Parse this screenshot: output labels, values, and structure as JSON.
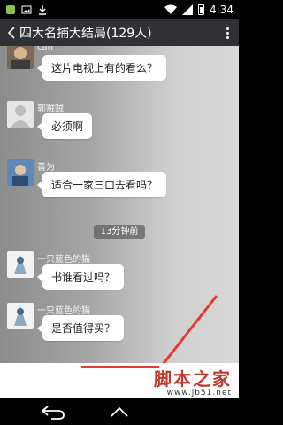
{
  "status_bar": {
    "time": "4:34",
    "left_icons": [
      "notification-icon",
      "image-icon",
      "download-icon"
    ],
    "right_icons": [
      "wifi-icon",
      "signal-icon",
      "battery-icon"
    ]
  },
  "header": {
    "title": "四大名捕大结局(129人)"
  },
  "messages": [
    {
      "name": "can",
      "text": "这片电视上有的看么？"
    },
    {
      "name": "郭贼贼",
      "text": "必须啊"
    },
    {
      "name": "善为",
      "text": "适合一家三口去看吗？"
    },
    {
      "name": "一只蓝色的猫",
      "text": "书谁看过吗？"
    },
    {
      "name": "一只蓝色的猫",
      "text": "是否值得买？"
    }
  ],
  "timestamp": "13分钟前",
  "watermark": {
    "main": "脚本之家",
    "url": "www.jb51.net"
  },
  "colors": {
    "header_bg": "#2f3134",
    "annotation_red": "#e53935",
    "watermark_red": "#c0392b"
  }
}
